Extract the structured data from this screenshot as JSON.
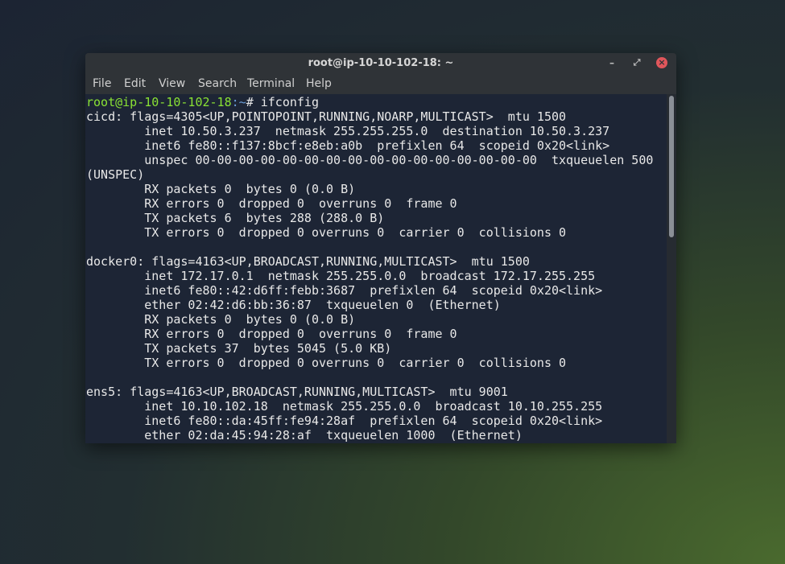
{
  "window": {
    "title": "root@ip-10-10-102-18: ~",
    "controls": {
      "minimize": "minimize-icon",
      "maximize": "maximize-icon",
      "close": "close-icon"
    },
    "close_color": "#e0565b"
  },
  "menu": [
    "File",
    "Edit",
    "View",
    "Search",
    "Terminal",
    "Help"
  ],
  "terminal": {
    "prompt_user": "root@ip-10-10-102-18",
    "prompt_path": ":~",
    "prompt_suffix": "# ",
    "command": "ifconfig",
    "output": [
      "cicd: flags=4305<UP,POINTOPOINT,RUNNING,NOARP,MULTICAST>  mtu 1500",
      "        inet 10.50.3.237  netmask 255.255.255.0  destination 10.50.3.237",
      "        inet6 fe80::f137:8bcf:e8eb:a0b  prefixlen 64  scopeid 0x20<link>",
      "        unspec 00-00-00-00-00-00-00-00-00-00-00-00-00-00-00-00  txqueuelen 500",
      "(UNSPEC)",
      "        RX packets 0  bytes 0 (0.0 B)",
      "        RX errors 0  dropped 0  overruns 0  frame 0",
      "        TX packets 6  bytes 288 (288.0 B)",
      "        TX errors 0  dropped 0 overruns 0  carrier 0  collisions 0",
      "",
      "docker0: flags=4163<UP,BROADCAST,RUNNING,MULTICAST>  mtu 1500",
      "        inet 172.17.0.1  netmask 255.255.0.0  broadcast 172.17.255.255",
      "        inet6 fe80::42:d6ff:febb:3687  prefixlen 64  scopeid 0x20<link>",
      "        ether 02:42:d6:bb:36:87  txqueuelen 0  (Ethernet)",
      "        RX packets 0  bytes 0 (0.0 B)",
      "        RX errors 0  dropped 0  overruns 0  frame 0",
      "        TX packets 37  bytes 5045 (5.0 KB)",
      "        TX errors 0  dropped 0 overruns 0  carrier 0  collisions 0",
      "",
      "ens5: flags=4163<UP,BROADCAST,RUNNING,MULTICAST>  mtu 9001",
      "        inet 10.10.102.18  netmask 255.255.0.0  broadcast 10.10.255.255",
      "        inet6 fe80::da:45ff:fe94:28af  prefixlen 64  scopeid 0x20<link>",
      "        ether 02:da:45:94:28:af  txqueuelen 1000  (Ethernet)"
    ]
  },
  "colors": {
    "prompt_user": "#8ae234",
    "prompt_path": "#6a9dd6",
    "terminal_bg": "#1d2535",
    "text": "#e8e8e8"
  }
}
